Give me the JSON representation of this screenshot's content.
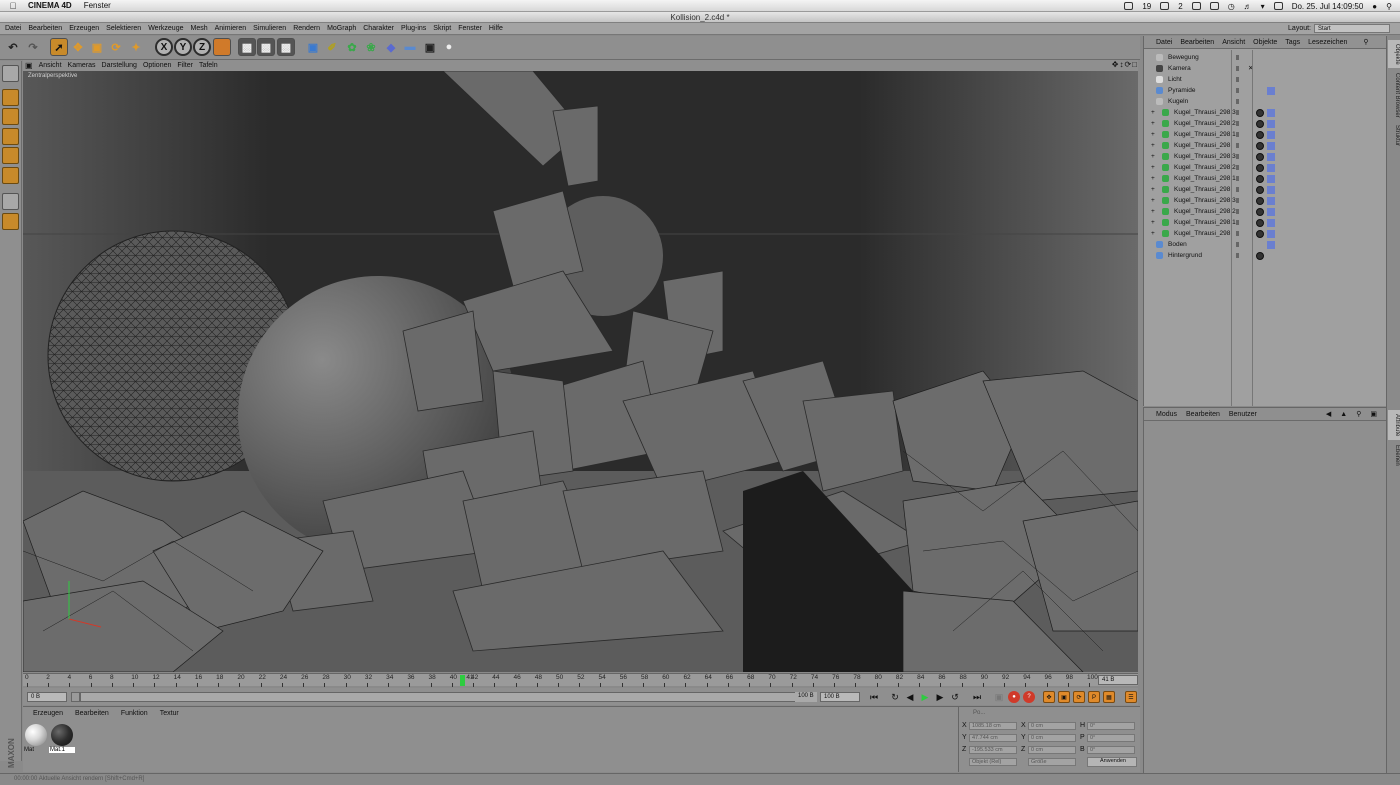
{
  "macbar": {
    "app_name": "CINEMA 4D",
    "menu": [
      "Fenster"
    ],
    "status_number": "19",
    "status_number2": "2",
    "datetime": "Do. 25. Jul  14:09:50"
  },
  "window": {
    "title": "Kollision_2.c4d *"
  },
  "appmenu": {
    "items": [
      "Datei",
      "Bearbeiten",
      "Erzeugen",
      "Selektieren",
      "Werkzeuge",
      "Mesh",
      "Animieren",
      "Simulieren",
      "Rendern",
      "MoGraph",
      "Charakter",
      "Plug-ins",
      "Skript",
      "Fenster",
      "Hilfe"
    ],
    "layout_label": "Layout:",
    "layout_value": "Start"
  },
  "toolbar": {
    "axis_x": "X",
    "axis_y": "Y",
    "axis_z": "Z"
  },
  "viewport": {
    "menu": [
      "Ansicht",
      "Kameras",
      "Darstellung",
      "Optionen",
      "Filter",
      "Tafeln"
    ],
    "perspective_label": "Zentralperspektive"
  },
  "timeline": {
    "ticks": [
      "0",
      "2",
      "4",
      "6",
      "8",
      "10",
      "12",
      "14",
      "16",
      "18",
      "20",
      "22",
      "24",
      "26",
      "28",
      "30",
      "32",
      "34",
      "36",
      "38",
      "40",
      "42",
      "44",
      "46",
      "48",
      "50",
      "52",
      "54",
      "56",
      "58",
      "60",
      "62",
      "64",
      "66",
      "68",
      "70",
      "72",
      "74",
      "76",
      "78",
      "80",
      "82",
      "84",
      "86",
      "88",
      "90",
      "92",
      "94",
      "96",
      "98",
      "100"
    ],
    "current_frame": 41,
    "current_label": "41",
    "end_field": "41 B",
    "start_field": "0 B",
    "min_field": "0 B",
    "max_field": "100 B",
    "range_end": "100 B"
  },
  "materials": {
    "menu": [
      "Erzeugen",
      "Bearbeiten",
      "Funktion",
      "Textur"
    ],
    "items": [
      {
        "label": "Mat",
        "color": "#d8d8d8"
      },
      {
        "label": "Mat.1",
        "color": "#2e2e2e"
      }
    ]
  },
  "coords": {
    "header": "Po...",
    "rows": [
      {
        "axis": "X",
        "pos": "1085.18 cm",
        "size_axis": "X",
        "size": "0 cm",
        "rot_axis": "H",
        "rot": "0°"
      },
      {
        "axis": "Y",
        "pos": "47.744 cm",
        "size_axis": "Y",
        "size": "0 cm",
        "rot_axis": "P",
        "rot": "0°"
      },
      {
        "axis": "Z",
        "pos": "-195.533 cm",
        "size_axis": "Z",
        "size": "0 cm",
        "rot_axis": "B",
        "rot": "0°"
      }
    ],
    "mode": "Objekt (Rel)",
    "size_mode": "Größe",
    "apply": "Anwenden"
  },
  "status": {
    "text": "00:00:00   Aktuelle Ansicht rendern [Shift+Cmd+R]"
  },
  "objects": {
    "menu": [
      "Datei",
      "Bearbeiten",
      "Ansicht",
      "Objekte",
      "Tags",
      "Lesezeichen"
    ],
    "rows": [
      {
        "name": "Bewegung",
        "indent": 0,
        "icon_color": "#bbbbbb",
        "tag": "none"
      },
      {
        "name": "Kamera",
        "indent": 0,
        "icon_color": "#444444",
        "tag": "cross"
      },
      {
        "name": "Licht",
        "indent": 0,
        "icon_color": "#dddddd",
        "tag": "none"
      },
      {
        "name": "Pyramide",
        "indent": 0,
        "icon_color": "#5a8ad0",
        "tag": "pair"
      },
      {
        "name": "Kugeln",
        "indent": 0,
        "icon_color": "#bbbbbb",
        "tag": "none"
      },
      {
        "name": "Kugel_Thrausi_298.3",
        "indent": 1,
        "icon_color": "#3aa84a",
        "tag": "ball"
      },
      {
        "name": "Kugel_Thrausi_298.2",
        "indent": 1,
        "icon_color": "#3aa84a",
        "tag": "ball"
      },
      {
        "name": "Kugel_Thrausi_298.1",
        "indent": 1,
        "icon_color": "#3aa84a",
        "tag": "ball"
      },
      {
        "name": "Kugel_Thrausi_298",
        "indent": 1,
        "icon_color": "#3aa84a",
        "tag": "ball"
      },
      {
        "name": "Kugel_Thrausi_298.3",
        "indent": 1,
        "icon_color": "#3aa84a",
        "tag": "ball"
      },
      {
        "name": "Kugel_Thrausi_298.2",
        "indent": 1,
        "icon_color": "#3aa84a",
        "tag": "ball"
      },
      {
        "name": "Kugel_Thrausi_298.1",
        "indent": 1,
        "icon_color": "#3aa84a",
        "tag": "ball"
      },
      {
        "name": "Kugel_Thrausi_298",
        "indent": 1,
        "icon_color": "#3aa84a",
        "tag": "ball"
      },
      {
        "name": "Kugel_Thrausi_298.3",
        "indent": 1,
        "icon_color": "#3aa84a",
        "tag": "ball"
      },
      {
        "name": "Kugel_Thrausi_298.2",
        "indent": 1,
        "icon_color": "#3aa84a",
        "tag": "ball"
      },
      {
        "name": "Kugel_Thrausi_298.1",
        "indent": 1,
        "icon_color": "#3aa84a",
        "tag": "ball"
      },
      {
        "name": "Kugel_Thrausi_298",
        "indent": 1,
        "icon_color": "#3aa84a",
        "tag": "ball"
      },
      {
        "name": "Boden",
        "indent": 0,
        "icon_color": "#5a8ad0",
        "tag": "pair"
      },
      {
        "name": "Hintergrund",
        "indent": 0,
        "icon_color": "#5a8ad0",
        "tag": "ballonly"
      }
    ]
  },
  "attributes": {
    "menu": [
      "Modus",
      "Bearbeiten",
      "Benutzer"
    ]
  },
  "sidetabs": {
    "top": [
      "Objekte",
      "Content Browser",
      "Struktur"
    ],
    "bottom": [
      "Attribute",
      "Ebenen"
    ]
  },
  "colors": {
    "accent_green": "#2ecc40",
    "record_red": "#d03a2a",
    "tool_orange": "#c88a2a"
  }
}
